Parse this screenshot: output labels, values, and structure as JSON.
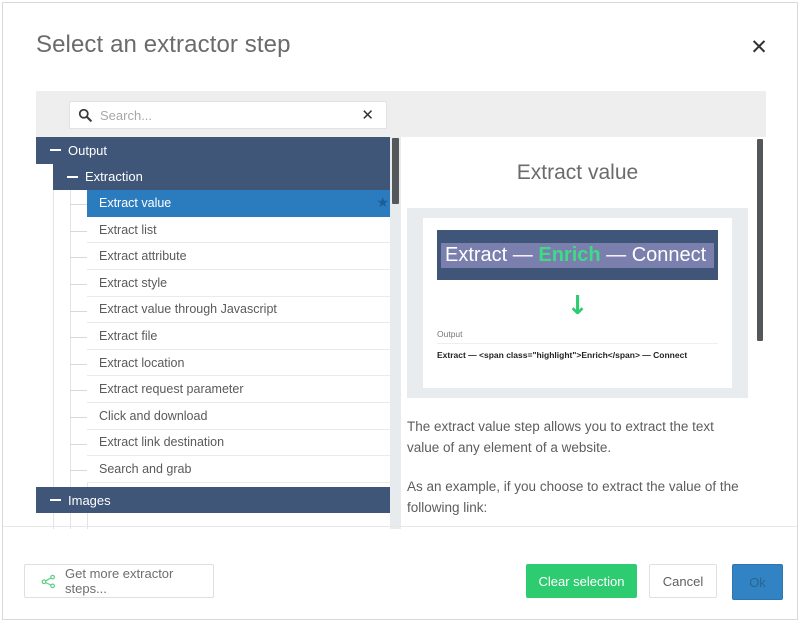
{
  "dialog": {
    "title": "Select an extractor step",
    "close_icon": "close-icon"
  },
  "search": {
    "placeholder": "Search...",
    "value": "",
    "icon": "search-icon",
    "clear_icon": "clear-icon"
  },
  "tree": {
    "groups": [
      {
        "label": "Output",
        "level": 0,
        "expanded": true
      },
      {
        "label": "Extraction",
        "level": 1,
        "expanded": true
      }
    ],
    "items": [
      {
        "label": "Extract value",
        "selected": true,
        "starred": true
      },
      {
        "label": "Extract list",
        "selected": false,
        "starred": false
      },
      {
        "label": "Extract attribute",
        "selected": false,
        "starred": false
      },
      {
        "label": "Extract style",
        "selected": false,
        "starred": false
      },
      {
        "label": "Extract value through Javascript",
        "selected": false,
        "starred": false
      },
      {
        "label": "Extract file",
        "selected": false,
        "starred": false
      },
      {
        "label": "Extract location",
        "selected": false,
        "starred": false
      },
      {
        "label": "Extract request parameter",
        "selected": false,
        "starred": false
      },
      {
        "label": "Click and download",
        "selected": false,
        "starred": false
      },
      {
        "label": "Extract link destination",
        "selected": false,
        "starred": false
      },
      {
        "label": "Search and grab",
        "selected": false,
        "starred": false
      }
    ],
    "trailing_group": {
      "label": "Images",
      "level": 0,
      "expanded": true
    }
  },
  "detail": {
    "title": "Extract value",
    "preview": {
      "banner": {
        "prefix": "Extract — ",
        "highlight": "Enrich",
        "suffix": " — Connect"
      },
      "arrow": "↓",
      "output_label": "Output",
      "output_value": "Extract — <span class=\"highlight\">Enrich</span> — Connect"
    },
    "paragraphs": [
      "The extract value step allows you to extract the text value of any element of a website.",
      "As an example, if you choose to extract the value of the following link:"
    ]
  },
  "footer": {
    "get_more_label": "Get more extractor steps...",
    "clear_label": "Clear selection",
    "cancel_label": "Cancel",
    "ok_label": "Ok"
  },
  "colors": {
    "group_row": "#3f5679",
    "selected_row": "#2b7cbf",
    "accent_green": "#2ecc71",
    "ok_blue": "#3283c3",
    "banner_highlight": "#3ddc84"
  }
}
